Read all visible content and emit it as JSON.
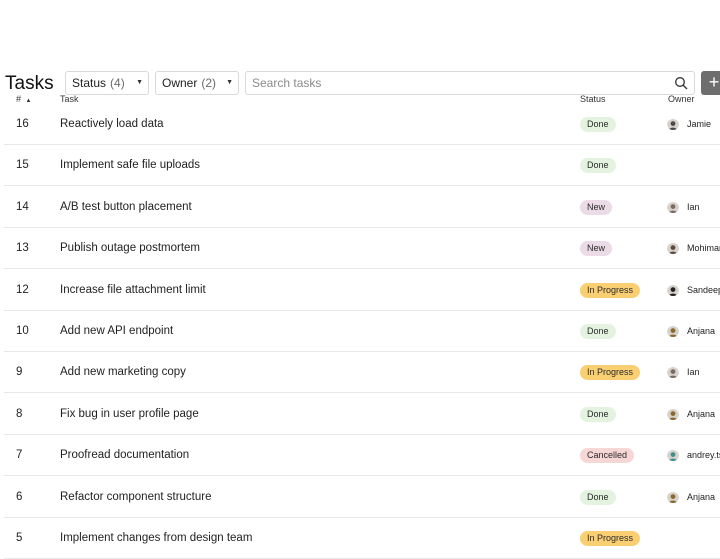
{
  "header": {
    "title": "Tasks",
    "status_filter": {
      "label": "Status",
      "count": "(4)"
    },
    "owner_filter": {
      "label": "Owner",
      "count": "(2)"
    },
    "search": {
      "placeholder": "Search tasks",
      "value": ""
    },
    "add_label": "+"
  },
  "columns": {
    "num": "#",
    "sort_indicator": "▲",
    "task": "Task",
    "status": "Status",
    "owner": "Owner"
  },
  "colors": {
    "Done": "#e3f3df",
    "New": "#eadbe6",
    "In Progress": "#f9cf72",
    "Cancelled": "#f7d6d6"
  },
  "rows": [
    {
      "num": "16",
      "task": "Reactively load data",
      "status": "Done",
      "owner": "Jamie",
      "avatar": "#4a4a4a"
    },
    {
      "num": "15",
      "task": "Implement safe file uploads",
      "status": "Done",
      "owner": "",
      "avatar": ""
    },
    {
      "num": "14",
      "task": "A/B test button placement",
      "status": "New",
      "owner": "Ian",
      "avatar": "#7a6b62"
    },
    {
      "num": "13",
      "task": "Publish outage postmortem",
      "status": "New",
      "owner": "Mohimar",
      "avatar": "#5c4a3c"
    },
    {
      "num": "12",
      "task": "Increase file attachment limit",
      "status": "In Progress",
      "owner": "Sandeep",
      "avatar": "#222222"
    },
    {
      "num": "10",
      "task": "Add new API endpoint",
      "status": "Done",
      "owner": "Anjana",
      "avatar": "#8a6a2a"
    },
    {
      "num": "9",
      "task": "Add new marketing copy",
      "status": "In Progress",
      "owner": "Ian",
      "avatar": "#7a6b62"
    },
    {
      "num": "8",
      "task": "Fix bug in user profile page",
      "status": "Done",
      "owner": "Anjana",
      "avatar": "#8a6a2a"
    },
    {
      "num": "7",
      "task": "Proofread documentation",
      "status": "Cancelled",
      "owner": "andrey.ts",
      "avatar": "#3f8f8c"
    },
    {
      "num": "6",
      "task": "Refactor component structure",
      "status": "Done",
      "owner": "Anjana",
      "avatar": "#8a6a2a"
    },
    {
      "num": "5",
      "task": "Implement changes from design team",
      "status": "In Progress",
      "owner": "",
      "avatar": ""
    }
  ]
}
